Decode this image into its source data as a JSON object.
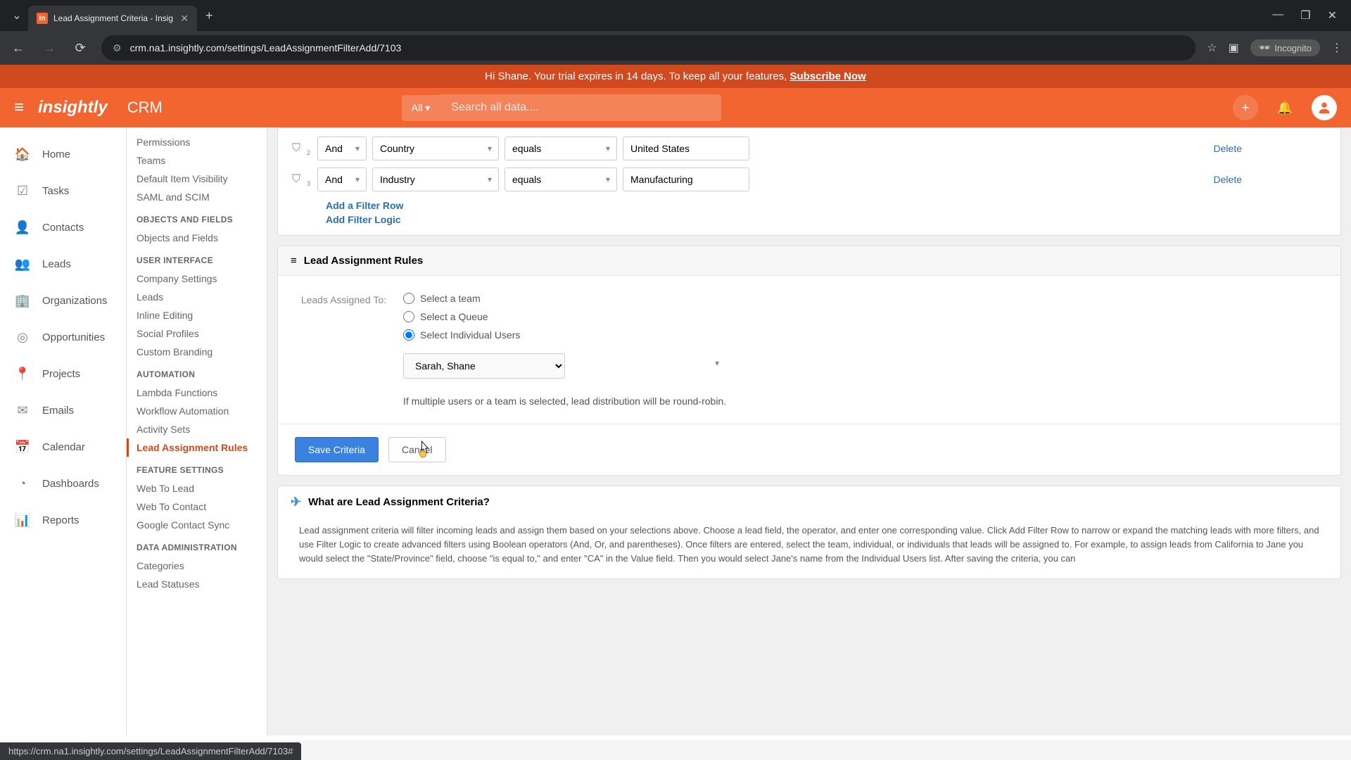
{
  "browser": {
    "tab_title": "Lead Assignment Criteria - Insig",
    "url": "crm.na1.insightly.com/settings/LeadAssignmentFilterAdd/7103",
    "incognito_label": "Incognito"
  },
  "trial_banner": {
    "greeting": "Hi Shane. Your trial expires in 14 days. To keep all your features, ",
    "cta": "Subscribe Now"
  },
  "header": {
    "logo": "insightly",
    "app_name": "CRM",
    "search_dropdown": "All",
    "search_placeholder": "Search all data...."
  },
  "left_nav": [
    {
      "icon": "home",
      "label": "Home"
    },
    {
      "icon": "tasks",
      "label": "Tasks"
    },
    {
      "icon": "contacts",
      "label": "Contacts"
    },
    {
      "icon": "leads",
      "label": "Leads"
    },
    {
      "icon": "orgs",
      "label": "Organizations"
    },
    {
      "icon": "opps",
      "label": "Opportunities"
    },
    {
      "icon": "projects",
      "label": "Projects"
    },
    {
      "icon": "emails",
      "label": "Emails"
    },
    {
      "icon": "calendar",
      "label": "Calendar"
    },
    {
      "icon": "dash",
      "label": "Dashboards"
    },
    {
      "icon": "reports",
      "label": "Reports"
    }
  ],
  "settings_nav": {
    "groups": [
      {
        "items": [
          "Permissions",
          "Teams",
          "Default Item Visibility",
          "SAML and SCIM"
        ]
      },
      {
        "title": "OBJECTS AND FIELDS",
        "items": [
          "Objects and Fields"
        ]
      },
      {
        "title": "USER INTERFACE",
        "items": [
          "Company Settings",
          "Leads",
          "Inline Editing",
          "Social Profiles",
          "Custom Branding"
        ]
      },
      {
        "title": "AUTOMATION",
        "items": [
          "Lambda Functions",
          "Workflow Automation",
          "Activity Sets",
          "Lead Assignment Rules"
        ]
      },
      {
        "title": "FEATURE SETTINGS",
        "items": [
          "Web To Lead",
          "Web To Contact",
          "Google Contact Sync"
        ]
      },
      {
        "title": "DATA ADMINISTRATION",
        "items": [
          "Categories",
          "Lead Statuses"
        ]
      }
    ],
    "active": "Lead Assignment Rules"
  },
  "filters": {
    "rows": [
      {
        "index": "2",
        "logic": "And",
        "field": "Country",
        "operator": "equals",
        "value": "United States"
      },
      {
        "index": "3",
        "logic": "And",
        "field": "Industry",
        "operator": "equals",
        "value": "Manufacturing"
      }
    ],
    "delete_label": "Delete",
    "add_row": "Add a Filter Row",
    "add_logic": "Add Filter Logic"
  },
  "rules": {
    "title": "Lead Assignment Rules",
    "label": "Leads Assigned To:",
    "options": [
      "Select a team",
      "Select a Queue",
      "Select Individual Users"
    ],
    "selected": 2,
    "user_value": "Sarah, Shane",
    "note": "If multiple users or a team is selected, lead distribution will be round-robin.",
    "save_label": "Save Criteria",
    "cancel_label": "Cancel"
  },
  "help": {
    "title": "What are Lead Assignment Criteria?",
    "body": "Lead assignment criteria will filter incoming leads and assign them based on your selections above. Choose a lead field, the operator, and enter one corresponding value. Click Add Filter Row to narrow or expand the matching leads with more filters, and use Filter Logic to create advanced filters using Boolean operators (And, Or, and parentheses). Once filters are entered, select the team, individual, or individuals that leads will be assigned to. For example, to assign leads from California to Jane you would select the \"State/Province\" field, choose \"is equal to,\" and enter \"CA\" in the Value field. Then you would select Jane's name from the Individual Users list. After saving the criteria, you can"
  },
  "status_bar": "https://crm.na1.insightly.com/settings/LeadAssignmentFilterAdd/7103#"
}
